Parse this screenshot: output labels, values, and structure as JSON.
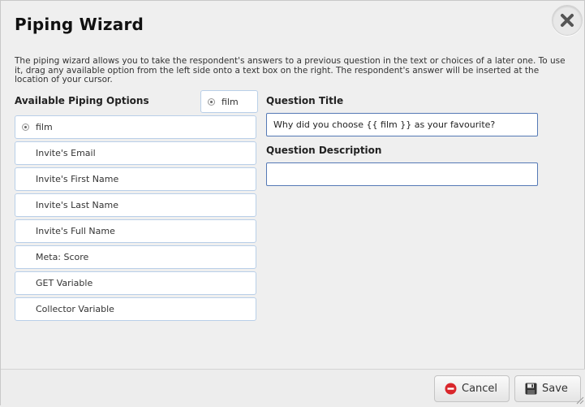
{
  "dialog": {
    "title": "Piping Wizard",
    "close_icon": "close-x-icon",
    "description": "The piping wizard allows you to take the respondent's answers to a previous question in the text or choices of a later one. To use it, drag any available option from the left side onto a text box on the right. The respondent's answer will be inserted at the location of your cursor."
  },
  "left": {
    "heading": "Available Piping Options",
    "dragging_chip": "film",
    "options": [
      "film",
      "Invite's Email",
      "Invite's First Name",
      "Invite's Last Name",
      "Invite's Full Name",
      "Meta: Score",
      "GET Variable",
      "Collector Variable"
    ]
  },
  "right": {
    "question_title_label": "Question Title",
    "question_title_value": "Why did you choose {{ film }} as your favourite?",
    "question_description_label": "Question Description",
    "question_description_value": ""
  },
  "footer": {
    "cancel_label": "Cancel",
    "save_label": "Save"
  },
  "colors": {
    "option_border": "#b9cfe8",
    "textbox_border": "#5579b5",
    "cancel_icon": "#d9262b"
  }
}
